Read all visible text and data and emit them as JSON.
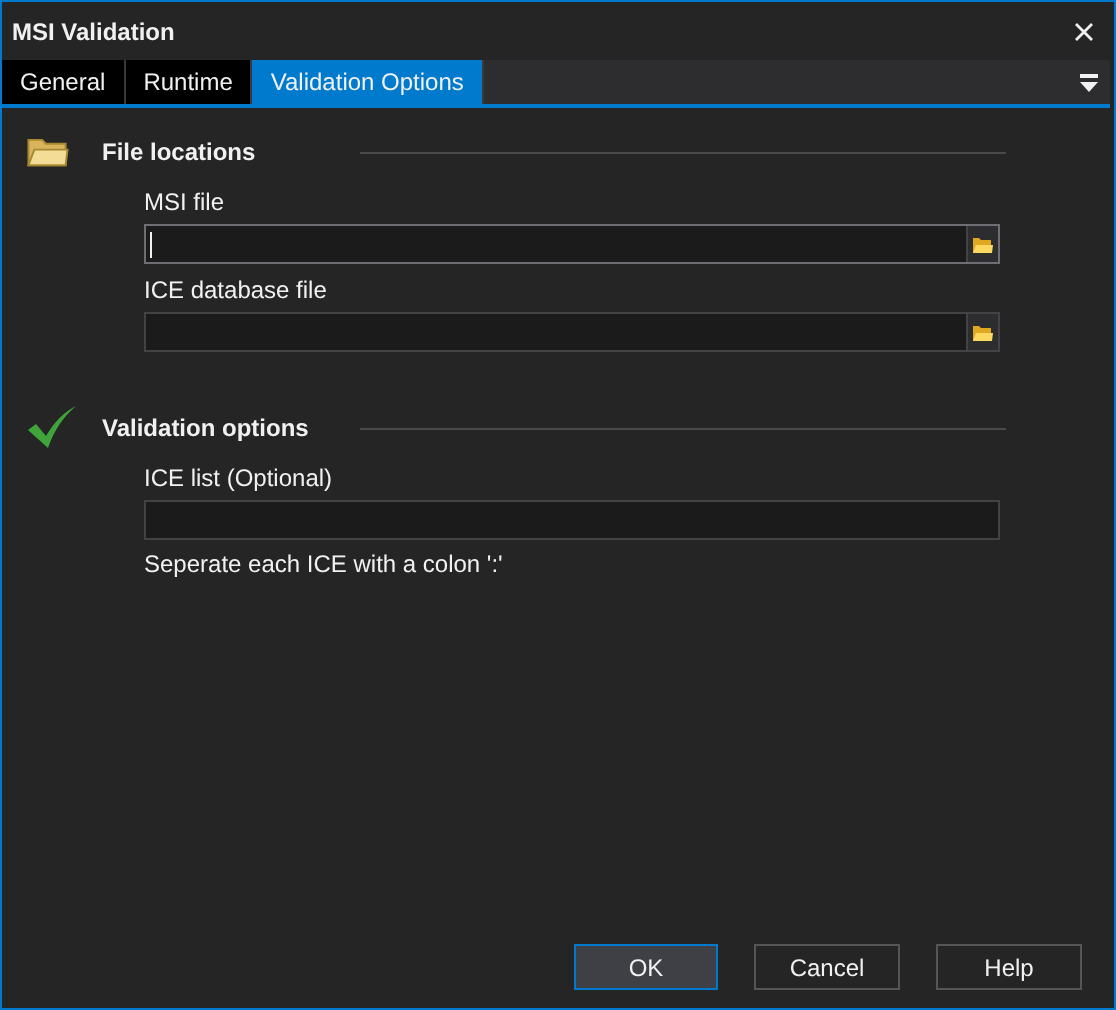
{
  "window": {
    "title": "MSI Validation"
  },
  "tabs": [
    {
      "label": "General",
      "selected": false
    },
    {
      "label": "Runtime",
      "selected": false
    },
    {
      "label": "Validation Options",
      "selected": true
    }
  ],
  "sections": [
    {
      "kind": "folder",
      "title": "File locations",
      "fields": [
        {
          "label": "MSI file",
          "kind": "browse",
          "focused": true
        },
        {
          "label": "ICE database file",
          "kind": "browse",
          "focused": false
        }
      ]
    },
    {
      "kind": "check",
      "title": "Validation options",
      "fields": [
        {
          "label": "ICE list (Optional)",
          "kind": "text",
          "focused": false,
          "hint": "Seperate each ICE with a colon ':'"
        }
      ]
    }
  ],
  "buttons": [
    {
      "label": "OK",
      "selected": true
    },
    {
      "label": "Cancel",
      "selected": false
    },
    {
      "label": "Help",
      "selected": false
    }
  ]
}
